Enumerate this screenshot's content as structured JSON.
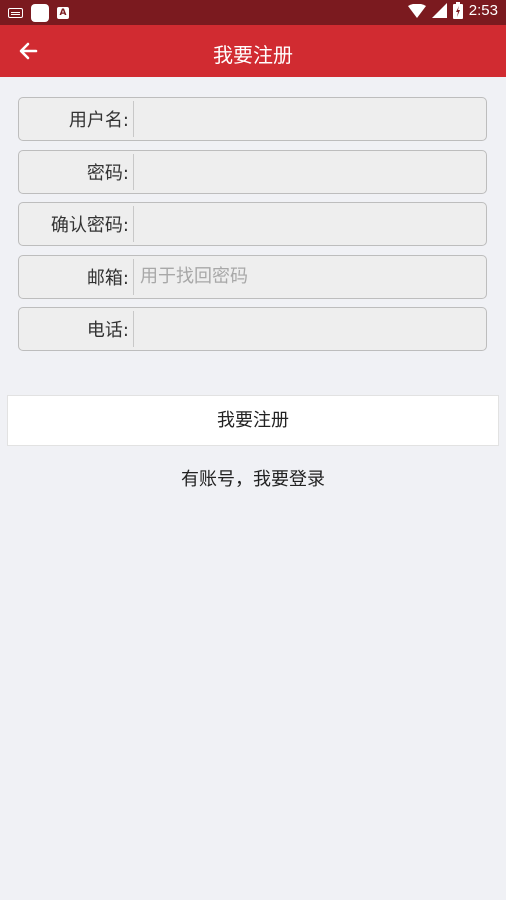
{
  "status_bar": {
    "time": "2:53",
    "icons": [
      "keyboard-icon",
      "app-notification-icon",
      "text-notification-icon",
      "wifi-icon",
      "signal-icon",
      "battery-icon"
    ],
    "background": "#7b1a1f"
  },
  "app_bar": {
    "title": "我要注册",
    "back_icon": "arrow-left-icon",
    "background": "#d12b31"
  },
  "form": {
    "fields": [
      {
        "label": "用户名:",
        "value": "",
        "placeholder": ""
      },
      {
        "label": "密码:",
        "value": "",
        "placeholder": ""
      },
      {
        "label": "确认密码:",
        "value": "",
        "placeholder": ""
      },
      {
        "label": "邮箱:",
        "value": "",
        "placeholder": "用于找回密码"
      },
      {
        "label": "电话:",
        "value": "",
        "placeholder": ""
      }
    ]
  },
  "register_button": {
    "label": "我要注册"
  },
  "login_link": {
    "label": "有账号，我要登录"
  }
}
